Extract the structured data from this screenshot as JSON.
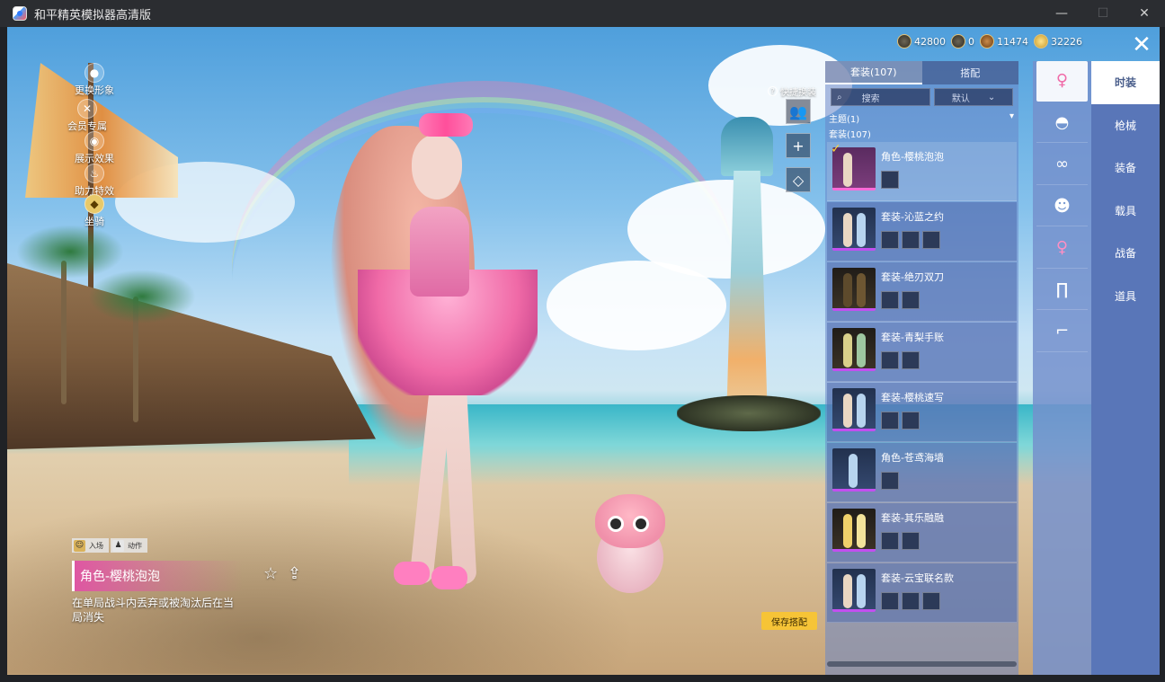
{
  "window": {
    "title": "和平精英模拟器高清版",
    "controls": {
      "minimize": "—",
      "maximize": "☐",
      "close": "✕"
    }
  },
  "left_menu": [
    {
      "label": "更换形象",
      "icon": "avatar-icon"
    },
    {
      "label": "会员专属",
      "icon": "member-icon"
    },
    {
      "label": "展示效果",
      "icon": "eye-icon"
    },
    {
      "label": "助力特效",
      "icon": "flame-icon"
    },
    {
      "label": "坐骑",
      "icon": "emblem-icon"
    }
  ],
  "currencies": [
    {
      "value": "42800",
      "icon": "coin-dark-icon"
    },
    {
      "value": "0",
      "icon": "coin-badge-icon"
    },
    {
      "value": "11474",
      "icon": "coin-bronze-icon"
    },
    {
      "value": "32226",
      "icon": "coin-gold-icon"
    }
  ],
  "close_button": "✕",
  "quick_swap": {
    "label": "快捷换装",
    "help": "?"
  },
  "tool_buttons": [
    {
      "icon": "outfit-figures-icon",
      "glyph": "👥"
    },
    {
      "icon": "add-icon",
      "glyph": "+"
    },
    {
      "icon": "diamond-icon",
      "glyph": "◇"
    }
  ],
  "panel": {
    "tabs": [
      {
        "label": "套装(107)",
        "active": true
      },
      {
        "label": "搭配",
        "active": false
      }
    ],
    "search_placeholder": "搜索",
    "sort_label": "默认",
    "theme_label": "主题(1)",
    "count_label": "套装(107)",
    "items": [
      {
        "title": "角色-樱桃泡泡",
        "style": "pink",
        "subicons": 1,
        "selected": true
      },
      {
        "title": "套装-沁蓝之约",
        "style": "blue",
        "subicons": 3,
        "selected": false
      },
      {
        "title": "套装-绝刃双刀",
        "style": "dark",
        "subicons": 2,
        "selected": false
      },
      {
        "title": "套装-青梨手账",
        "style": "dark",
        "subicons": 2,
        "selected": false
      },
      {
        "title": "套装-樱桃速写",
        "style": "blue",
        "subicons": 2,
        "selected": false
      },
      {
        "title": "角色-苍鸢海墙",
        "style": "blue",
        "subicons": 1,
        "selected": false
      },
      {
        "title": "套装-其乐融融",
        "style": "dark",
        "subicons": 2,
        "selected": false
      },
      {
        "title": "套装-云宝联名款",
        "style": "blue",
        "subicons": 3,
        "selected": false
      }
    ]
  },
  "icon_column": [
    {
      "icon": "character-icon",
      "glyph": "♀",
      "active": true
    },
    {
      "icon": "hat-icon",
      "glyph": "◓",
      "active": false
    },
    {
      "icon": "glasses-icon",
      "glyph": "∞",
      "active": false
    },
    {
      "icon": "face-icon",
      "glyph": "☻",
      "active": false
    },
    {
      "icon": "outfit-icon",
      "glyph": "♀",
      "active": false
    },
    {
      "icon": "pants-icon",
      "glyph": "∏",
      "active": false
    },
    {
      "icon": "shoes-icon",
      "glyph": "⌐",
      "active": false
    }
  ],
  "categories": [
    {
      "label": "时装",
      "active": true
    },
    {
      "label": "枪械",
      "active": false
    },
    {
      "label": "装备",
      "active": false
    },
    {
      "label": "载具",
      "active": false
    },
    {
      "label": "战备",
      "active": false
    },
    {
      "label": "道具",
      "active": false
    }
  ],
  "bottom_left": {
    "chips": [
      {
        "label": "入场",
        "icon": "☺"
      },
      {
        "label": "动作",
        "icon": "♟"
      }
    ],
    "selected_name": "角色-樱桃泡泡",
    "description": "在单局战斗内丢弃或被淘汰后在当局消失",
    "fav_glyph": "☆",
    "share_glyph": "⇪"
  },
  "save_button": "保存搭配"
}
